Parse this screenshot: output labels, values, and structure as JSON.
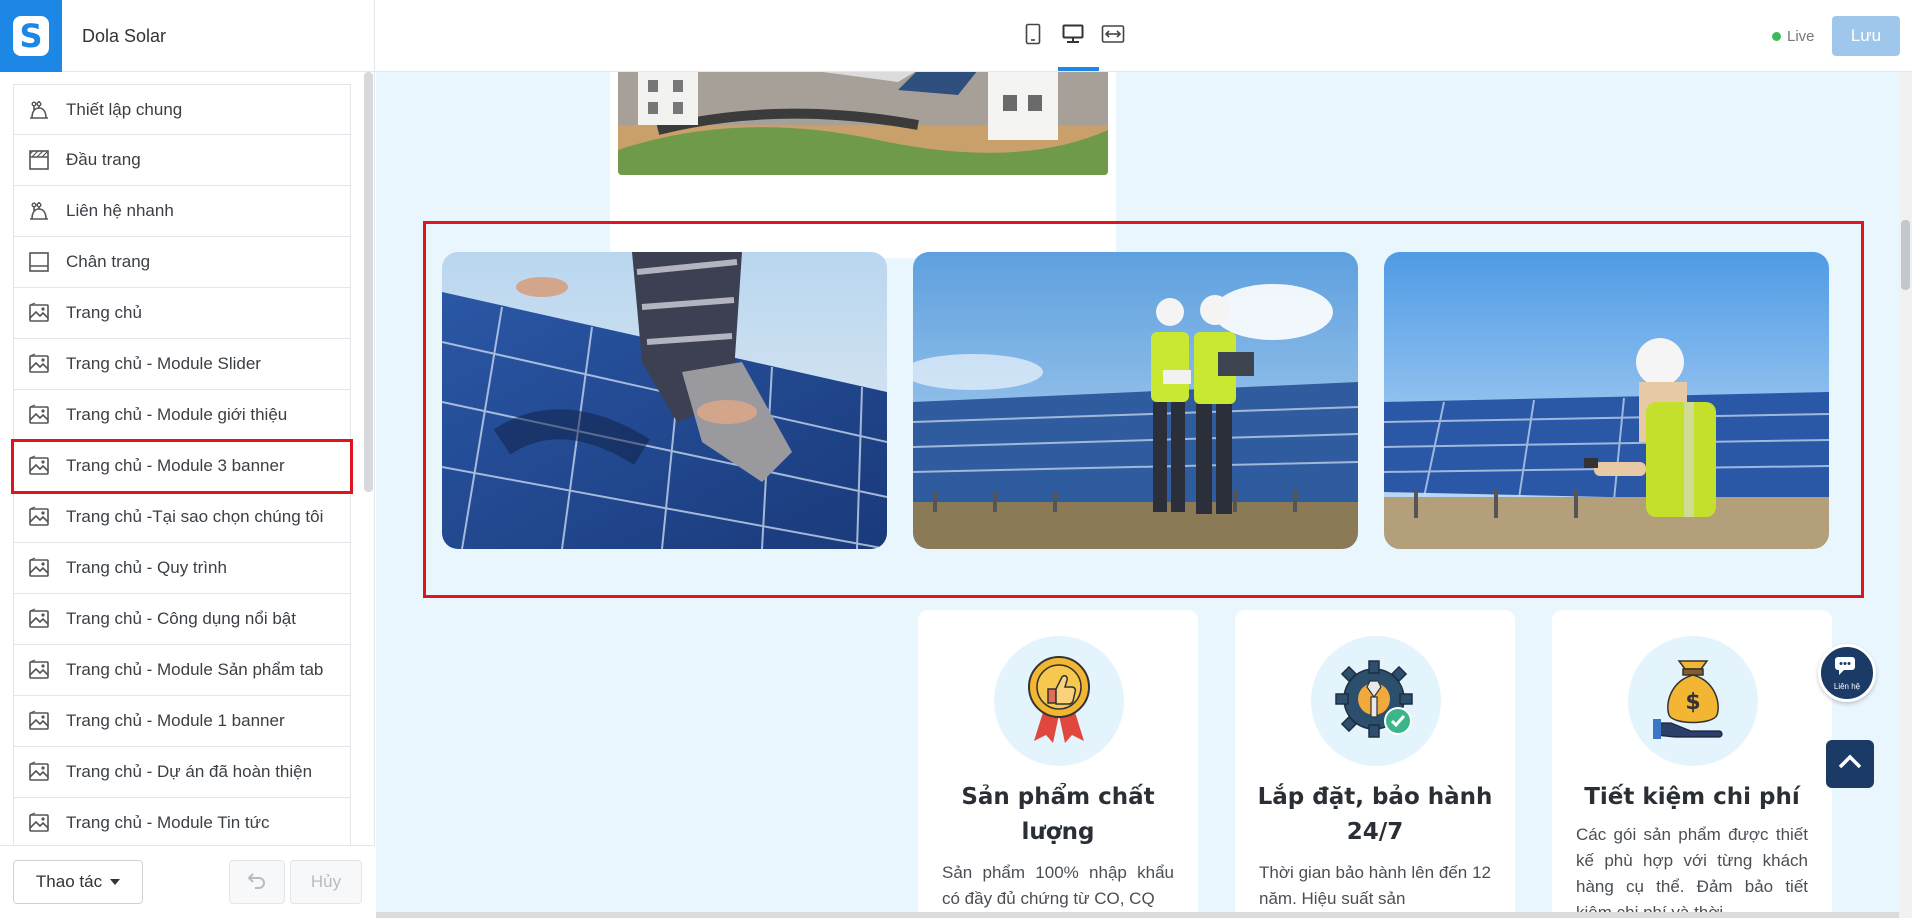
{
  "app": {
    "shop_name": "Dola Solar",
    "logo_letter": "S",
    "live_label": "Live",
    "save_label": "Lưu",
    "brand_color": "#1c87e5"
  },
  "view_toggle": [
    {
      "name": "mobile-view",
      "icon": "mobile-icon"
    },
    {
      "name": "desktop-view",
      "icon": "desktop-icon",
      "active": true
    },
    {
      "name": "fullwidth-view",
      "icon": "fullwidth-icon"
    }
  ],
  "sidebar": {
    "items": [
      {
        "label": "Thiết lập chung",
        "icon": "settings-sliders-icon"
      },
      {
        "label": "Đầu trang",
        "icon": "header-layout-icon"
      },
      {
        "label": "Liên hệ nhanh",
        "icon": "settings-sliders-icon"
      },
      {
        "label": "Chân trang",
        "icon": "footer-layout-icon"
      },
      {
        "label": "Trang chủ",
        "icon": "page-image-icon"
      },
      {
        "label": "Trang chủ - Module Slider",
        "icon": "page-image-icon"
      },
      {
        "label": "Trang chủ - Module giới thiệu",
        "icon": "page-image-icon"
      },
      {
        "label": "Trang chủ - Module 3 banner",
        "icon": "page-image-icon",
        "selected": true
      },
      {
        "label": "Trang chủ -Tại sao chọn chúng tôi",
        "icon": "page-image-icon"
      },
      {
        "label": "Trang chủ - Quy trình",
        "icon": "page-image-icon"
      },
      {
        "label": "Trang chủ - Công dụng nổi bật",
        "icon": "page-image-icon"
      },
      {
        "label": "Trang chủ - Module Sản phẩm tab",
        "icon": "page-image-icon"
      },
      {
        "label": "Trang chủ - Module 1 banner",
        "icon": "page-image-icon"
      },
      {
        "label": "Trang chủ - Dự án đã hoàn thiện",
        "icon": "page-image-icon"
      },
      {
        "label": "Trang chủ - Module Tin tức",
        "icon": "page-image-icon"
      }
    ],
    "footer": {
      "actions_label": "Thao tác",
      "cancel_label": "Hủy"
    }
  },
  "preview": {
    "banners": [
      {
        "name": "banner-technician-panel",
        "alt": "solar-panel-installation-image"
      },
      {
        "name": "banner-engineers-field",
        "alt": "engineers-solar-farm-image"
      },
      {
        "name": "banner-engineer-inspecting",
        "alt": "engineer-inspecting-panels-image"
      }
    ],
    "features": [
      {
        "title_line1": "Sản phẩm chất",
        "title_line2": "lượng",
        "desc": "Sản phẩm 100% nhập khẩu có đầy đủ chứng từ CO, CQ",
        "icon": "quality-badge-icon"
      },
      {
        "title_line1": "Lắp đặt, bảo hành",
        "title_line2": "24/7",
        "desc": "Thời gian bảo hành lên đến 12 năm. Hiệu suất sản",
        "icon": "gear-wrench-icon"
      },
      {
        "title_line1": "Tiết kiệm chi phí",
        "title_line2": "",
        "desc": "Các gói sản phẩm được thiết kế phù hợp với từng khách hàng cụ thể. Đảm bảo tiết kiệm chi phí và thời",
        "icon": "money-bag-icon"
      }
    ],
    "contact_fab_label": "Liên hệ"
  }
}
